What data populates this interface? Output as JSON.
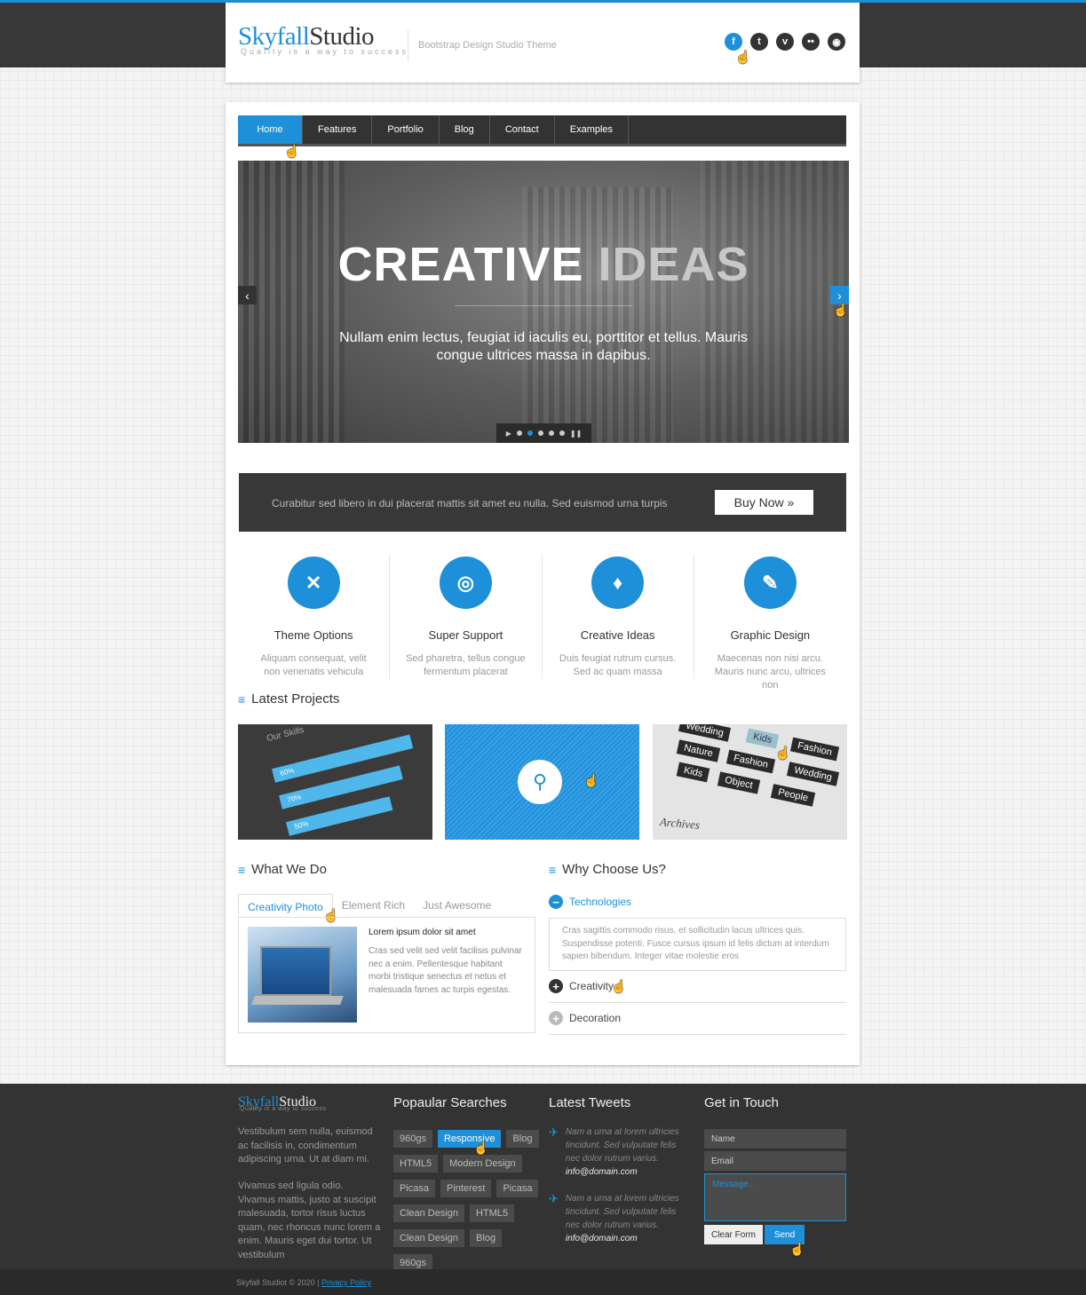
{
  "header": {
    "logo_a": "Skyfall",
    "logo_b": "Studio",
    "tagline": "Quality is a way to success",
    "description": "Bootstrap Design Studio Theme",
    "social": [
      {
        "icon": "facebook-icon",
        "glyph": "f"
      },
      {
        "icon": "twitter-icon",
        "glyph": "t"
      },
      {
        "icon": "vimeo-icon",
        "glyph": "v"
      },
      {
        "icon": "flickr-icon",
        "glyph": "••"
      },
      {
        "icon": "rss-icon",
        "glyph": "◉"
      }
    ]
  },
  "nav": {
    "items": [
      "Home",
      "Features",
      "Portfolio",
      "Blog",
      "Contact",
      "Examples"
    ],
    "active": "Home"
  },
  "slider": {
    "title_a": "CREATIVE",
    "title_b": "IDEAS",
    "text": "Nullam enim lectus, feugiat id iaculis eu, porttitor et tellus. Mauris congue ultrices massa in dapibus.",
    "prev": "‹",
    "next": "›",
    "active_dot": 1
  },
  "cta": {
    "text": "Curabitur sed libero in dui placerat mattis sit amet eu nulla. Sed euismod urna turpis",
    "button": "Buy Now »"
  },
  "features": [
    {
      "icon": "tools-icon",
      "glyph": "✕",
      "title": "Theme Options",
      "desc": "Aliquam consequat, velit non venenatis vehicula"
    },
    {
      "icon": "lifebuoy-icon",
      "glyph": "◎",
      "title": "Super Support",
      "desc": "Sed pharetra, tellus congue fermentum placerat"
    },
    {
      "icon": "lightbulb-icon",
      "glyph": "♦",
      "title": "Creative Ideas",
      "desc": "Duis feugiat rutrum cursus. Sed ac quam massa"
    },
    {
      "icon": "brush-icon",
      "glyph": "✎",
      "title": "Graphic Design",
      "desc": "Maecenas non nisi arcu. Mauris nunc arcu, ultrices non"
    }
  ],
  "projects": {
    "title": "Latest Projects",
    "skills": {
      "heading": "Our Skills",
      "bars": [
        "60%",
        "70%",
        "50%"
      ]
    },
    "tags": [
      "Wedding",
      "Kids",
      "Fashion",
      "Nature",
      "Fashion",
      "Wedding",
      "Kids",
      "Object",
      "People"
    ],
    "archives": "Archives"
  },
  "what_we_do": {
    "title": "What We Do",
    "tabs": [
      "Creativity Photo",
      "Element Rich",
      "Just Awesome"
    ],
    "heading": "Lorem ipsum dolor sit amet",
    "text": "Cras sed velit sed velit facilisis pulvinar nec a enim. Pellentesque habitant morbi tristique senectus et netus et malesuada fames ac turpis egestas."
  },
  "why": {
    "title": "Why Choose Us?",
    "items": [
      {
        "label": "Technologies",
        "body": "Cras sagittis commodo risus, et sollicitudin lacus ultrices quis. Suspendisse potenti. Fusce cursus ipsum id felis dictum at interdum sapien bibendum. Integer vitae molestie eros"
      },
      {
        "label": "Creativity"
      },
      {
        "label": "Decoration"
      }
    ]
  },
  "footer": {
    "logo_a": "Skyfall",
    "logo_b": "Studio",
    "tagline": "Quality is a way to success",
    "text1": "Vestibulum sem nulla, euismod ac facilisis in, condimentum adipiscing urna. Ut at diam mi.",
    "text2": "Vivamus sed ligula odio. Vivamus mattis, justo at suscipit malesuada, tortor risus luctus quam, nec rhoncus nunc lorem a enim. Mauris eget dui tortor. Ut vestibulum",
    "searches_title": "Popaular Searches",
    "searches": [
      "960gs",
      "Responsive",
      "Blog",
      "HTML5",
      "Modern Design",
      "Picasa",
      "Pinterest",
      "Picasa",
      "Clean Design",
      "HTML5",
      "Clean Design",
      "Blog",
      "960gs"
    ],
    "tweets_title": "Latest Tweets",
    "tweets": [
      {
        "text": "Nam a urna at lorem ultricies tincidunt. Sed vulputate felis nec dolor rutrum varius.",
        "mail": "info@domain.com"
      },
      {
        "text": "Nam a urna at lorem ultricies tincidunt. Sed vulputate felis nec dolor rutrum varius.",
        "mail": "info@domain.com"
      }
    ],
    "contact_title": "Get in Touch",
    "name_ph": "Name",
    "email_ph": "Email",
    "message_ph": "Message..",
    "clear": "Clear Form",
    "send": "Send"
  },
  "bottom": {
    "copyright": "Skyfall Studiot  ©  2020  |  ",
    "privacy": "Privacy Policy"
  },
  "colors": {
    "accent": "#1e90d9",
    "dark": "#333333"
  }
}
